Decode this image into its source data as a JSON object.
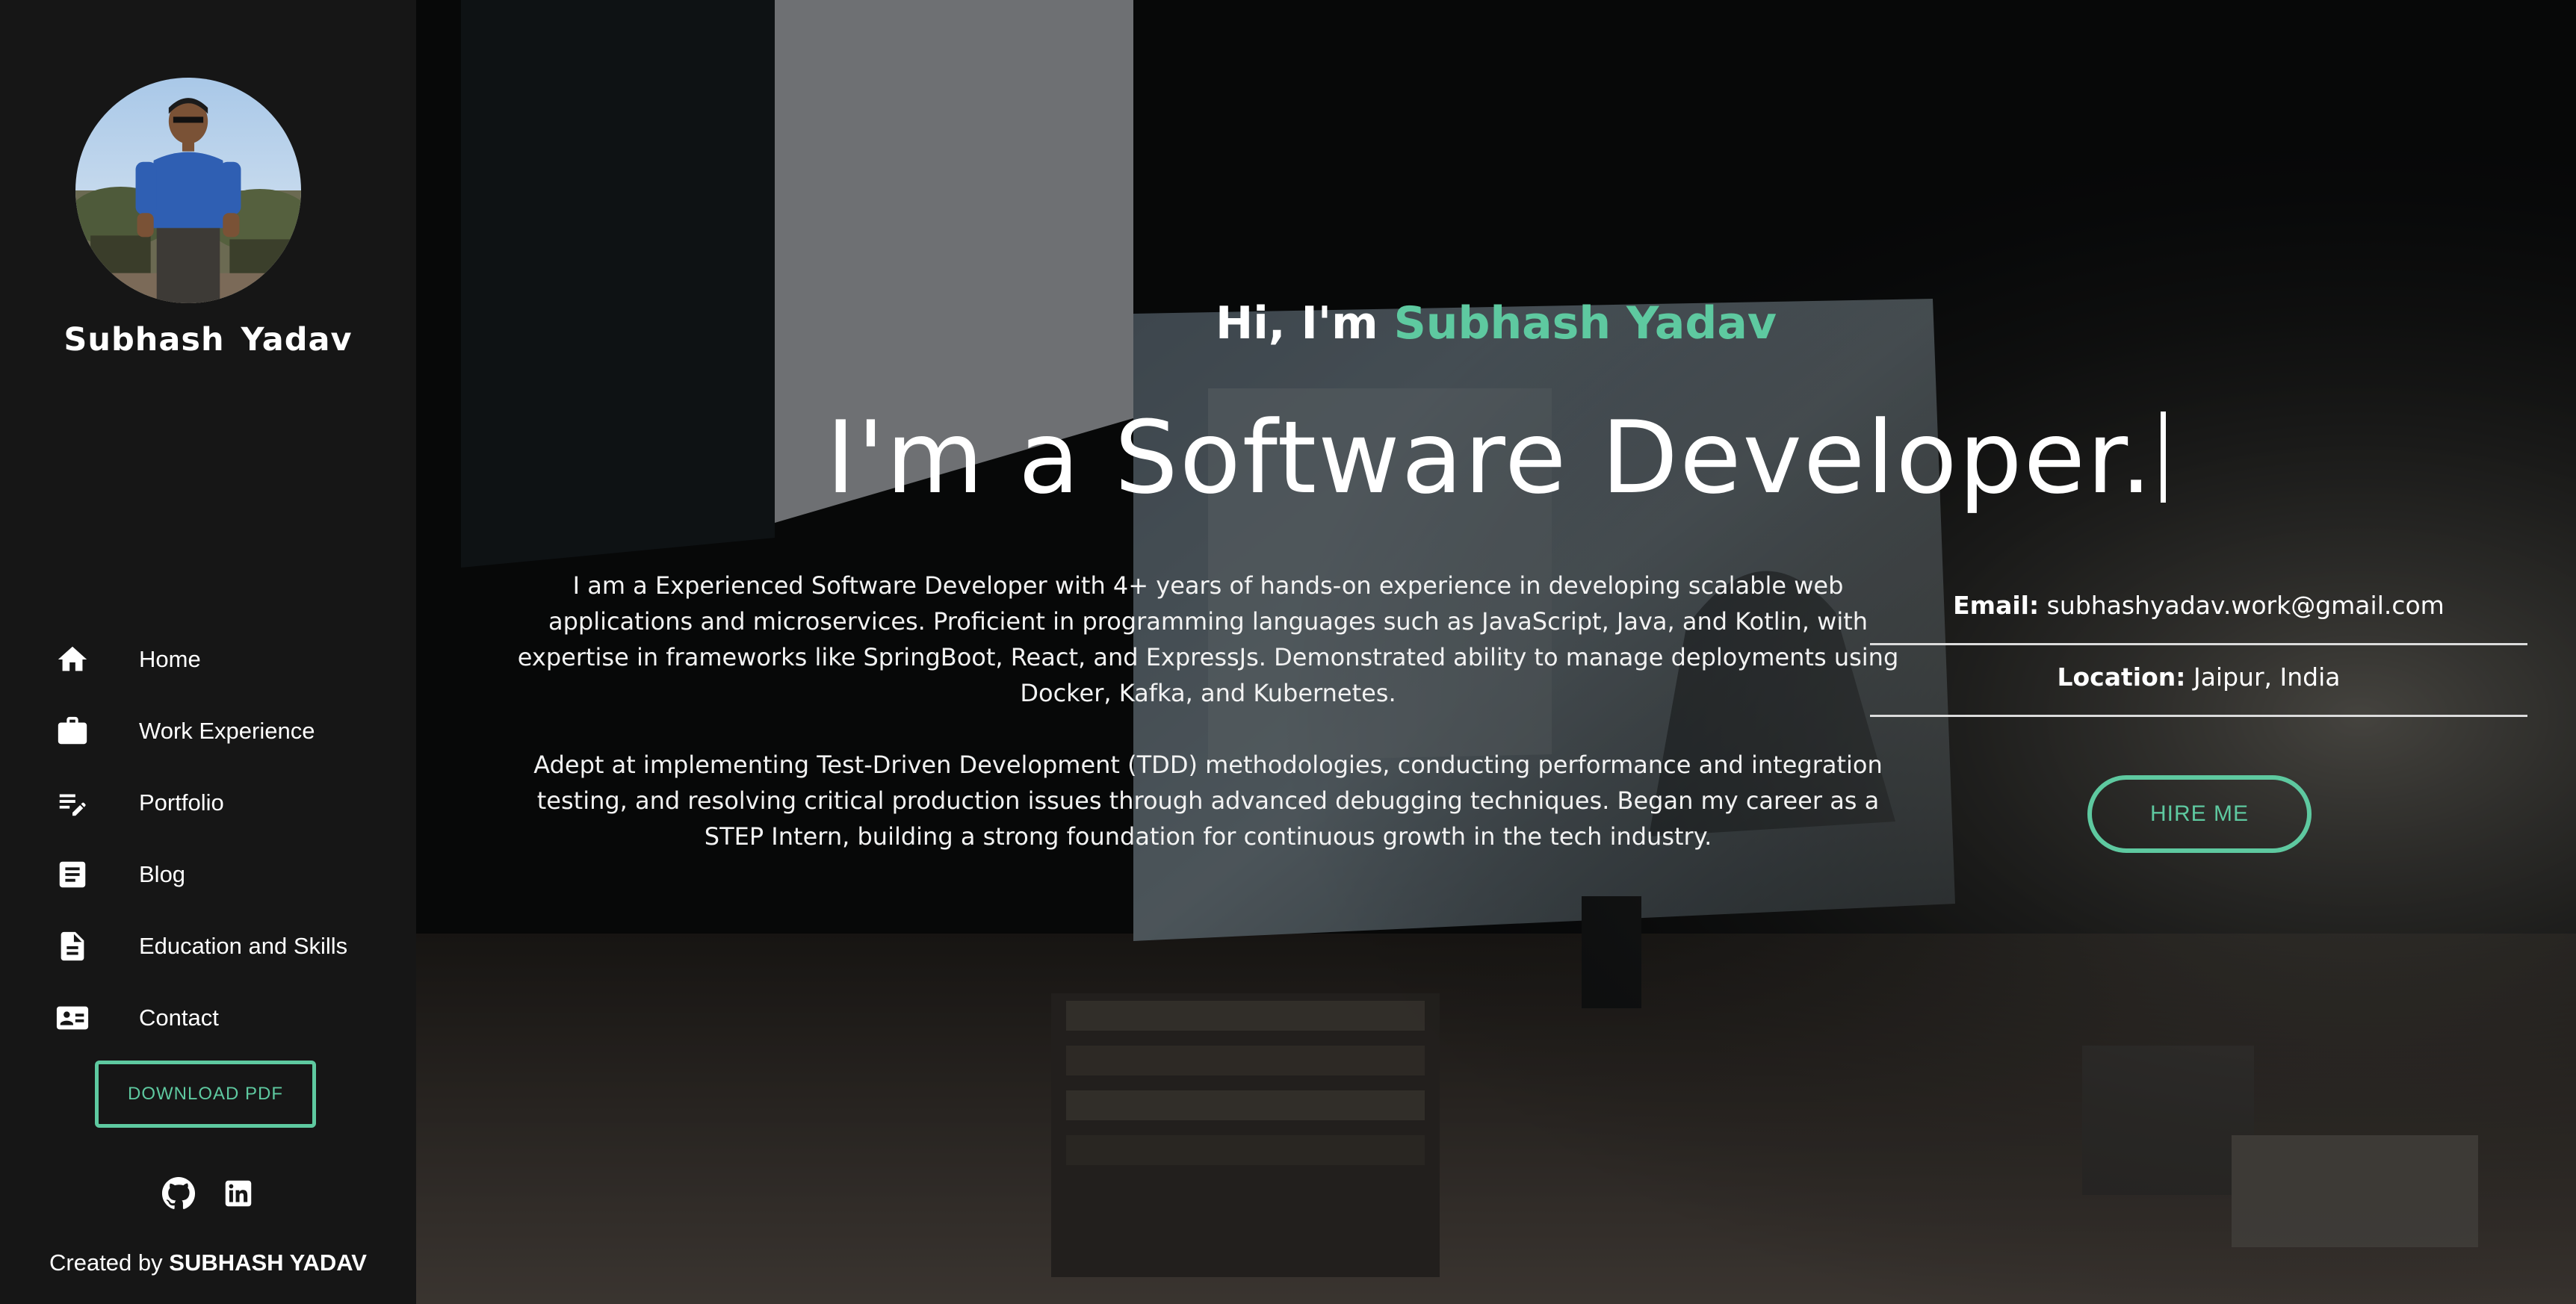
{
  "sidebar": {
    "name": "Subhash  Yadav",
    "nav": [
      {
        "label": "Home",
        "icon": "home-icon"
      },
      {
        "label": "Work Experience",
        "icon": "briefcase-icon"
      },
      {
        "label": "Portfolio",
        "icon": "edit-note-icon"
      },
      {
        "label": "Blog",
        "icon": "article-icon"
      },
      {
        "label": "Education and Skills",
        "icon": "document-icon"
      },
      {
        "label": "Contact",
        "icon": "contact-card-icon"
      }
    ],
    "download_label": "DOWNLOAD PDF",
    "socials": [
      "github-icon",
      "linkedin-icon"
    ],
    "credit_prefix": "Created by ",
    "credit_name": "SUBHASH YADAV"
  },
  "hero": {
    "greeting_prefix": "Hi, I'm ",
    "greeting_name": "Subhash Yadav",
    "headline": "I'm a Software Developer.",
    "about": [
      "I am a Experienced Software Developer with 4+ years of hands-on experience in developing scalable web applications and microservices. Proficient in programming languages such as JavaScript, Java, and Kotlin, with expertise in frameworks like SpringBoot, React, and ExpressJs. Demonstrated ability to manage deployments using Docker, Kafka, and Kubernetes.",
      "Adept at implementing Test-Driven Development (TDD) methodologies, conducting performance and integration testing, and resolving critical production issues through advanced debugging techniques. Began my career as a STEP Intern, building a strong foundation for continuous growth in the tech industry."
    ],
    "email_label": "Email:",
    "email_value": "subhashyadav.work@gmail.com",
    "location_label": "Location:",
    "location_value": "Jaipur, India",
    "hire_label": "HIRE ME"
  },
  "colors": {
    "accent": "#5ec9a0",
    "sidebar_bg": "#161616"
  }
}
